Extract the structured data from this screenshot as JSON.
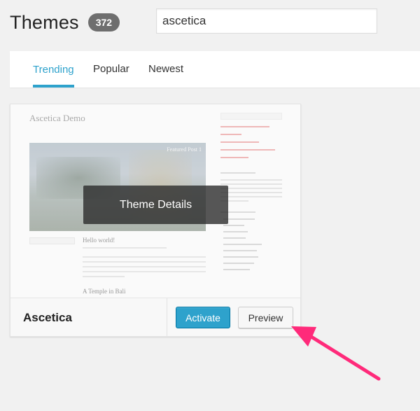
{
  "header": {
    "title": "Themes",
    "count": "372"
  },
  "search": {
    "value": "ascetica"
  },
  "tabs": [
    {
      "label": "Trending",
      "active": true
    },
    {
      "label": "Popular",
      "active": false
    },
    {
      "label": "Newest",
      "active": false
    }
  ],
  "theme_card": {
    "name": "Ascetica",
    "details_label": "Theme Details",
    "activate_label": "Activate",
    "preview_label": "Preview",
    "screenshot": {
      "demo_title": "Ascetica Demo",
      "featured_label": "Featured Post 1",
      "post_title": "Hello world!",
      "second_post_title": "A Temple in Bali"
    }
  },
  "colors": {
    "accent": "#2ea2cc",
    "annotation_arrow": "#ff2a7a"
  },
  "annotation": {
    "icon": "arrow-pointer-icon"
  }
}
